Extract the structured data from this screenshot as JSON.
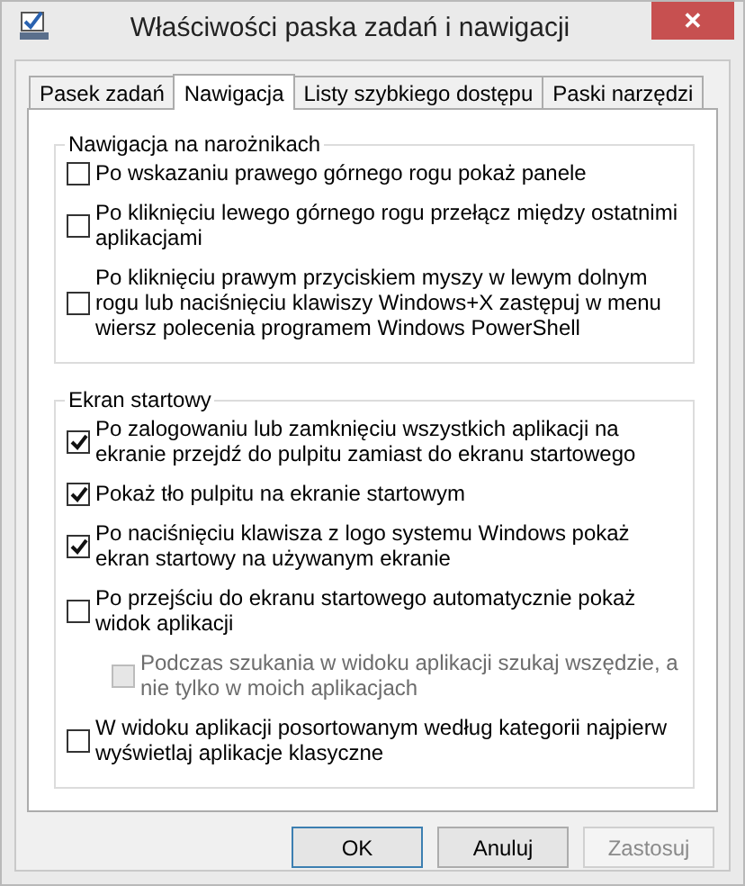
{
  "window": {
    "title": "Właściwości paska zadań i nawigacji",
    "close": "✕"
  },
  "tabs": [
    {
      "label": "Pasek zadań",
      "selected": false
    },
    {
      "label": "Nawigacja",
      "selected": true
    },
    {
      "label": "Listy szybkiego dostępu",
      "selected": false
    },
    {
      "label": "Paski narzędzi",
      "selected": false
    }
  ],
  "groups": [
    {
      "title": "Nawigacja na narożnikach",
      "options": [
        {
          "label": "Po wskazaniu prawego górnego rogu pokaż panele",
          "checked": false,
          "disabled": false
        },
        {
          "label": "Po kliknięciu lewego górnego rogu przełącz między ostatnimi aplikacjami",
          "checked": false,
          "disabled": false
        },
        {
          "label": "Po kliknięciu prawym przyciskiem myszy w lewym dolnym rogu lub naciśnięciu klawiszy Windows+X zastępuj w menu wiersz polecenia programem Windows PowerShell",
          "checked": false,
          "disabled": false
        }
      ]
    },
    {
      "title": "Ekran startowy",
      "options": [
        {
          "label": "Po zalogowaniu lub zamknięciu wszystkich aplikacji na ekranie przejdź do pulpitu zamiast do ekranu startowego",
          "checked": true,
          "disabled": false
        },
        {
          "label": "Pokaż tło pulpitu na ekranie startowym",
          "checked": true,
          "disabled": false
        },
        {
          "label": "Po naciśnięciu klawisza z logo systemu Windows pokaż ekran startowy na używanym ekranie",
          "checked": true,
          "disabled": false
        },
        {
          "label": "Po przejściu do ekranu startowego automatycznie pokaż widok aplikacji",
          "checked": false,
          "disabled": false,
          "children": [
            {
              "label": "Podczas szukania w widoku aplikacji szukaj wszędzie, a nie tylko w moich aplikacjach",
              "checked": false,
              "disabled": true
            }
          ]
        },
        {
          "label": "W widoku aplikacji posortowanym według kategorii najpierw wyświetlaj aplikacje klasyczne",
          "checked": false,
          "disabled": false
        }
      ]
    }
  ],
  "buttons": [
    {
      "label": "OK",
      "default": true,
      "disabled": false
    },
    {
      "label": "Anuluj",
      "default": false,
      "disabled": false
    },
    {
      "label": "Zastosuj",
      "default": false,
      "disabled": true
    }
  ]
}
